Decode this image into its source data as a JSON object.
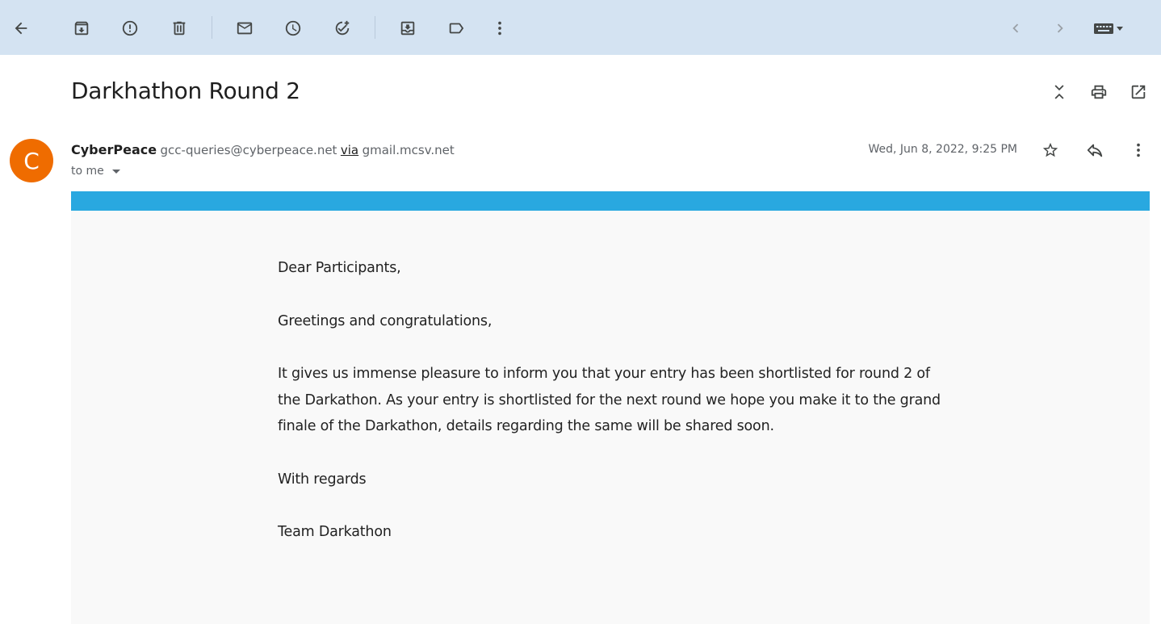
{
  "toolbar": {
    "actions": [
      "back-icon",
      "archive-icon",
      "report-spam-icon",
      "delete-icon",
      "mark-unread-icon",
      "snooze-icon",
      "add-to-tasks-icon",
      "move-to-icon",
      "label-icon",
      "more-vert-icon"
    ],
    "nav": [
      "prev-icon",
      "next-icon",
      "input-tools-icon"
    ]
  },
  "email": {
    "subject": "Darkhathon Round 2",
    "avatar_letter": "C",
    "avatar_color": "#ef6c00",
    "sender_name": "CyberPeace",
    "sender_email": "gcc-queries@cyberpeace.net",
    "via_label": "via",
    "via_domain": "gmail.mcsv.net",
    "to_label": "to me",
    "date": "Wed, Jun 8, 2022, 9:25 PM",
    "banner_color": "#29a8e0",
    "body": {
      "greeting": "Dear Participants,",
      "line2": "Greetings and congratulations,",
      "paragraph": "It gives us immense pleasure to inform you that your entry has been shortlisted for round 2 of the Darkathon. As your entry is shortlisted for the next round we hope you make it to the grand finale of the Darkathon, details regarding the same will be shared soon.",
      "closing": "With regards",
      "signature": "Team Darkathon"
    }
  }
}
